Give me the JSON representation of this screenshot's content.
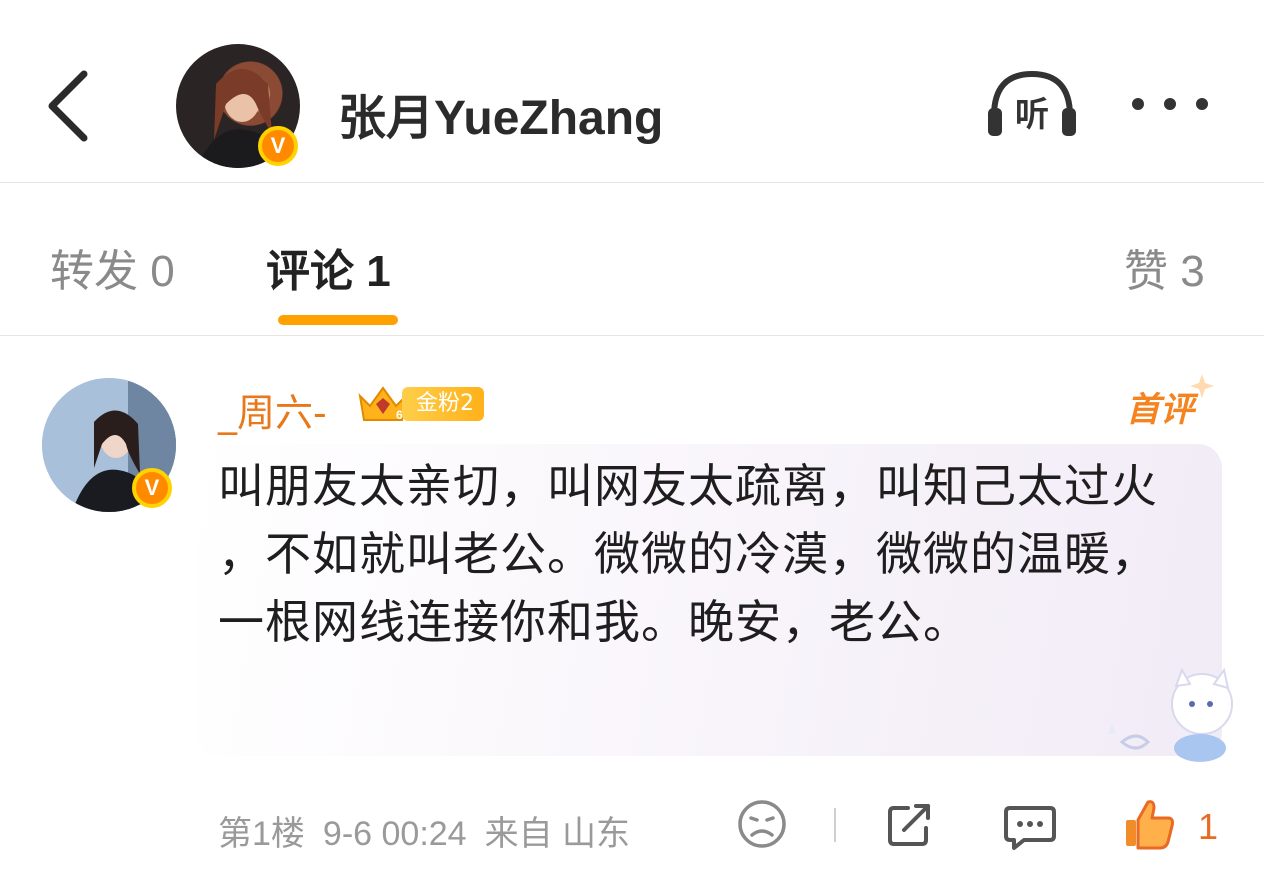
{
  "header": {
    "title": "张月YueZhang",
    "listen_label": "听",
    "verified_badge": "V",
    "icons": [
      "back-arrow-icon",
      "headphones-icon",
      "more-dots-icon"
    ]
  },
  "tabs": [
    {
      "label": "转发 0"
    },
    {
      "label": "评论 1"
    },
    {
      "label": "赞 3"
    }
  ],
  "active_tab_index": 1,
  "comment": {
    "username": "_周六-",
    "verified_badge": "V",
    "fan_badge": "金粉2",
    "fan_badge_level": "6",
    "first_comment_label": "首评",
    "text": "叫朋友太亲切，叫网友太疏离，叫知己太过火 ，不如就叫老公。微微的冷漠，微微的温暖，一根网线连接你和我。晚安，老公。",
    "floor": "第1楼",
    "time": "9-6 00:24",
    "source": "来自 山东",
    "like_count": "1"
  },
  "colors": {
    "accent": "#ffa200",
    "username": "#e8781a",
    "like": "#e96a23",
    "muted": "#9a9a9a"
  }
}
